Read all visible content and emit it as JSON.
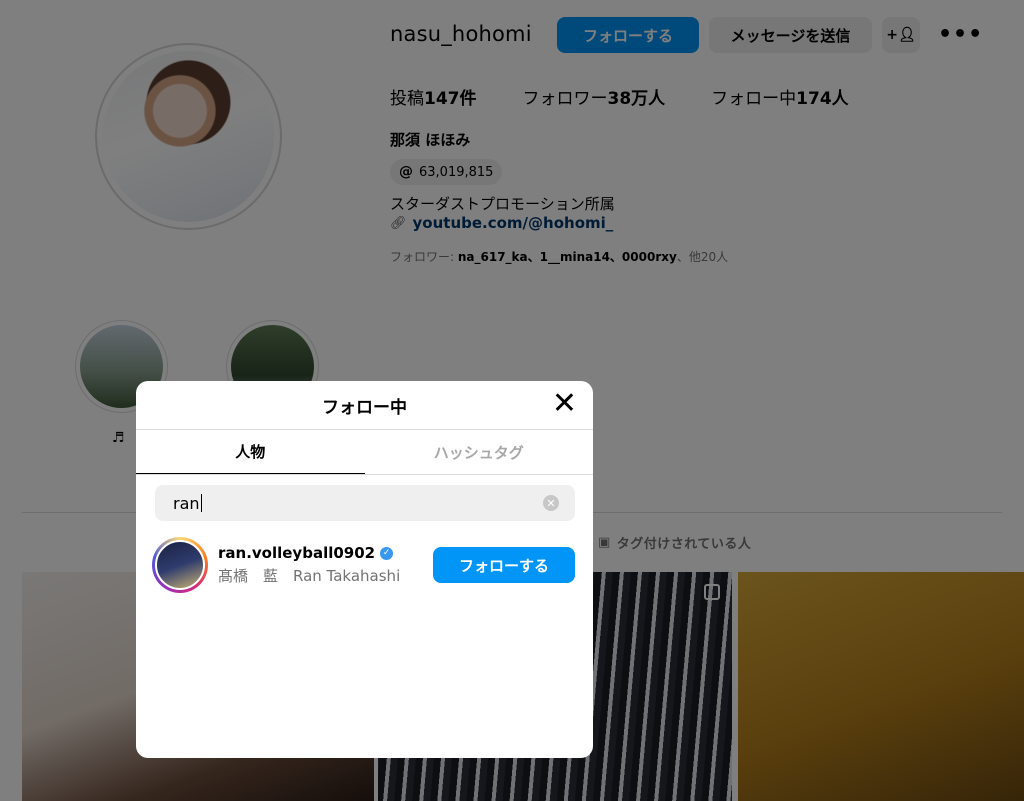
{
  "profile": {
    "username": "nasu_hohomi",
    "follow_label": "フォローする",
    "message_label": "メッセージを送信",
    "add_user_icon": "+person-icon",
    "more_icon": "•••",
    "stats": {
      "posts_label": "投稿",
      "posts_value": "147件",
      "followers_label": "フォロワー",
      "followers_value": "38万人",
      "following_label": "フォロー中",
      "following_value": "174人"
    },
    "full_name": "那須 ほほみ",
    "threads_count": "63,019,815",
    "bio": "スターダストプロモーション所属",
    "link": "youtube.com/@hohomi_",
    "followed_by_label": "フォロワー: ",
    "followed_by_names": "na_617_ka、1__mina14、0000rxy",
    "followed_by_more": "、他20人"
  },
  "highlights": [
    {
      "label": "♬"
    },
    {
      "label": ""
    }
  ],
  "tabs_bar": {
    "tagged_label": "タグ付けされている人"
  },
  "modal": {
    "title": "フォロー中",
    "close_icon": "✕",
    "tabs": [
      "人物",
      "ハッシュタグ"
    ],
    "search": {
      "value": "ran"
    },
    "results": [
      {
        "username": "ran.volleyball0902",
        "full_name": "髙橋　藍　Ran Takahashi",
        "verified": true,
        "button_label": "フォローする"
      }
    ]
  },
  "colors": {
    "primary_button": "#0095f6",
    "link": "#00376b",
    "overlay": "rgba(0,0,0,0.5)"
  }
}
